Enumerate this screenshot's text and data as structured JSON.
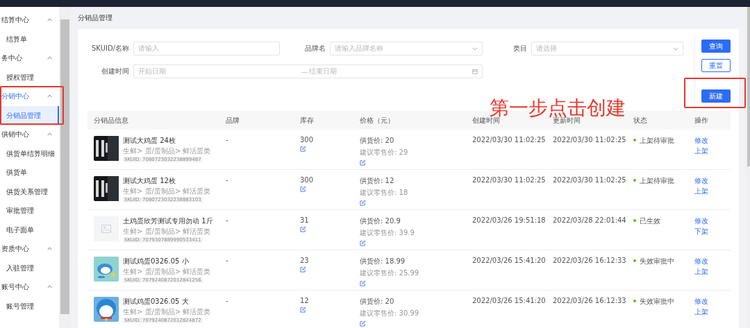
{
  "sidebar": {
    "groups": [
      {
        "label": "结算中心",
        "selected": false,
        "expanded": true,
        "children": [
          {
            "label": "结算单",
            "selected": false
          }
        ]
      },
      {
        "label": "务中心",
        "selected": false,
        "expanded": true,
        "children": [
          {
            "label": "授权管理",
            "selected": false
          }
        ]
      },
      {
        "label": "分销中心",
        "selected": true,
        "expanded": true,
        "children": [
          {
            "label": "分销品管理",
            "selected": true
          }
        ]
      },
      {
        "label": "供销中心",
        "selected": false,
        "expanded": true,
        "children": [
          {
            "label": "供货单结算明细",
            "selected": false
          },
          {
            "label": "供货单",
            "selected": false
          },
          {
            "label": "供货关系管理",
            "selected": false
          },
          {
            "label": "审批管理",
            "selected": false
          },
          {
            "label": "电子面单",
            "selected": false
          }
        ]
      },
      {
        "label": "资质中心",
        "selected": false,
        "expanded": true,
        "children": [
          {
            "label": "入驻管理",
            "selected": false
          }
        ]
      },
      {
        "label": "账号中心",
        "selected": false,
        "expanded": true,
        "children": [
          {
            "label": "账号管理",
            "selected": false
          }
        ]
      }
    ]
  },
  "page_title": "分销品管理",
  "filters": [
    {
      "label": "SKUID/名称",
      "placeholder": "请输入",
      "kind": "input"
    },
    {
      "label": "品牌名",
      "placeholder": "请输入品牌名称",
      "kind": "select"
    },
    {
      "label": "类目",
      "placeholder": "请选择",
      "kind": "select"
    }
  ],
  "date_range": {
    "label": "创建时间",
    "start_placeholder": "开始日期",
    "separator": "—",
    "end_placeholder": "结束日期"
  },
  "buttons": {
    "query": "查询",
    "reset": "重置",
    "create": "新建"
  },
  "annotation": "第一步点击创建",
  "table": {
    "columns": [
      "分销品信息",
      "品牌",
      "库存",
      "价格（元）",
      "创建时间",
      "更新时间",
      "状态",
      "操作"
    ],
    "rows": [
      {
        "thumbnail": {
          "kind": "picture"
        },
        "name": "测试大鸡蛋 24枚",
        "category": "生鲜> 蛋/蛋制品> 鲜活蛋类",
        "skuid": "SKUID: 7080723032238899487",
        "brand": "-",
        "stock": "300",
        "supply_price": "供货价: 20",
        "retail_price": "建议零售价: 29",
        "created": "2022/03/30 11:02:25",
        "updated": "2022/03/30 11:02:25",
        "status": "上架待审批",
        "color": "#52c41a",
        "actions": [
          "修改",
          "上架"
        ]
      },
      {
        "thumbnail": {
          "kind": "picture"
        },
        "name": "测试大鸡蛋 12枚",
        "category": "生鲜> 蛋/蛋制品> 鲜活蛋类",
        "skuid": "SKUID: 7080723032238883103",
        "brand": "-",
        "stock": "300",
        "supply_price": "供货价: 12",
        "retail_price": "建议零售价: 18",
        "created": "2022/03/30 11:02:25",
        "updated": "2022/03/30 11:02:25",
        "status": "上架待审批",
        "color": "#52c41a",
        "actions": [
          "修改",
          "上架"
        ]
      },
      {
        "thumbnail": {
          "kind": "placeholder"
        },
        "name": "土鸡蛋欣芳测试专用勿动 1斤",
        "category": "生鲜> 蛋/蛋制品> 鲜活蛋类",
        "skuid": "SKUID: 7079307889990533411",
        "brand": "-",
        "stock": "31",
        "supply_price": "供货价: 20.9",
        "retail_price": "建议零售价: 39.9",
        "created": "2022/03/26 19:51:18",
        "updated": "2022/03/28 22:01:44",
        "status": "已生效",
        "color": "#52c41a",
        "actions": [
          "修改",
          "下架"
        ]
      },
      {
        "thumbnail": {
          "kind": "picture"
        },
        "name": "测试鸡蛋0326.05 小",
        "category": "生鲜> 蛋/蛋制品> 鲜活蛋类",
        "skuid": "SKUID: 7079240872012841256",
        "brand": "-",
        "stock": "23",
        "supply_price": "供货价: 18.99",
        "retail_price": "建议零售价: 25.99",
        "created": "2022/03/26 15:41:20",
        "updated": "2022/03/26 16:12:33",
        "status": "失效审批中",
        "color": "#52c41a",
        "actions": [
          "修改",
          "上架"
        ]
      },
      {
        "thumbnail": {
          "kind": "picture"
        },
        "name": "测试鸡蛋0326.05 大",
        "category": "生鲜> 蛋/蛋制品> 鲜活蛋类",
        "skuid": "SKUID: 7079240872012824872",
        "brand": "-",
        "stock": "12",
        "supply_price": "供货价: 20",
        "retail_price": "建议零售价: 30.99",
        "created": "2022/03/26 15:41:20",
        "updated": "2022/03/26 16:12:33",
        "status": "失效审批中",
        "color": "#52c41a",
        "actions": [
          "修改",
          "上架"
        ]
      }
    ]
  }
}
